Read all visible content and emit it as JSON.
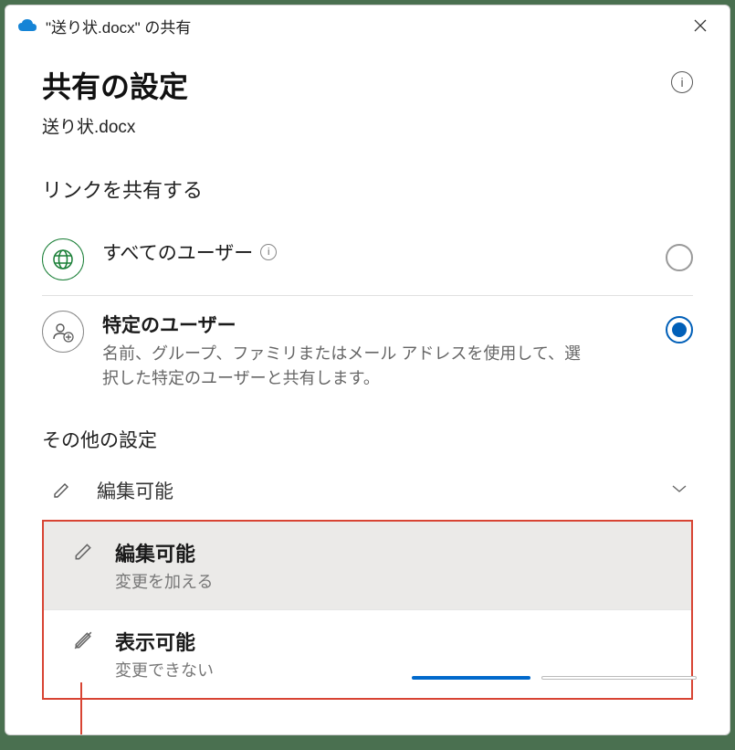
{
  "titlebar": {
    "title": "\"送り状.docx\" の共有"
  },
  "header": {
    "page_title": "共有の設定",
    "filename": "送り状.docx"
  },
  "link_section": {
    "label": "リンクを共有する",
    "options": [
      {
        "title": "すべてのユーザー",
        "selected": false
      },
      {
        "title": "特定のユーザー",
        "desc": "名前、グループ、ファミリまたはメール アドレスを使用して、選択した特定のユーザーと共有します。",
        "selected": true
      }
    ]
  },
  "other_section": {
    "label": "その他の設定",
    "dropdown_value": "編集可能",
    "menu": [
      {
        "title": "編集可能",
        "desc": "変更を加える",
        "selected": true
      },
      {
        "title": "表示可能",
        "desc": "変更できない",
        "selected": false
      }
    ]
  }
}
